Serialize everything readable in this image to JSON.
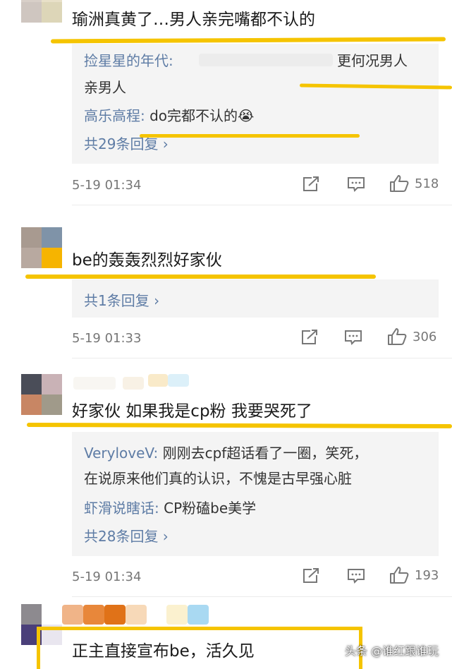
{
  "comments": [
    {
      "text": "瑜洲真黄了…男人亲完嘴都不认的",
      "replies": [
        {
          "user": "捡星星的年代",
          "sep": ":",
          "text_end": "更何况男人",
          "text_line2": "亲男人"
        },
        {
          "user": "高乐高程",
          "sep": ":",
          "text": " do完都不认的😭"
        }
      ],
      "more": "共29条回复 ›",
      "time": "5-19 01:34",
      "likes": "518"
    },
    {
      "text": "be的轰轰烈烈好家伙",
      "more": "共1条回复 ›",
      "time": "5-19 01:33",
      "likes": "306"
    },
    {
      "text": "好家伙 如果我是cp粉 我要哭死了",
      "replies": [
        {
          "user": "VeryloveV",
          "sep": ":",
          "text": " 刚刚去cpf超话看了一圈，笑死，",
          "text_line2": "在说原来他们真的认识，不愧是古早强心脏"
        },
        {
          "user": "虾滑说瞎话",
          "sep": ":",
          "text": " CP粉磕be美学"
        }
      ],
      "more": "共28条回复 ›",
      "time": "5-19 01:34",
      "likes": "193"
    },
    {
      "text": "正主直接宣布be，活久见"
    }
  ],
  "watermark": "头条 @谁红跟谁玩",
  "colors": {
    "highlight": "#f5c400",
    "link": "#5e7ca5",
    "reply_bg": "#f4f4f4"
  },
  "icons": [
    "share-icon",
    "comment-icon",
    "like-icon"
  ]
}
